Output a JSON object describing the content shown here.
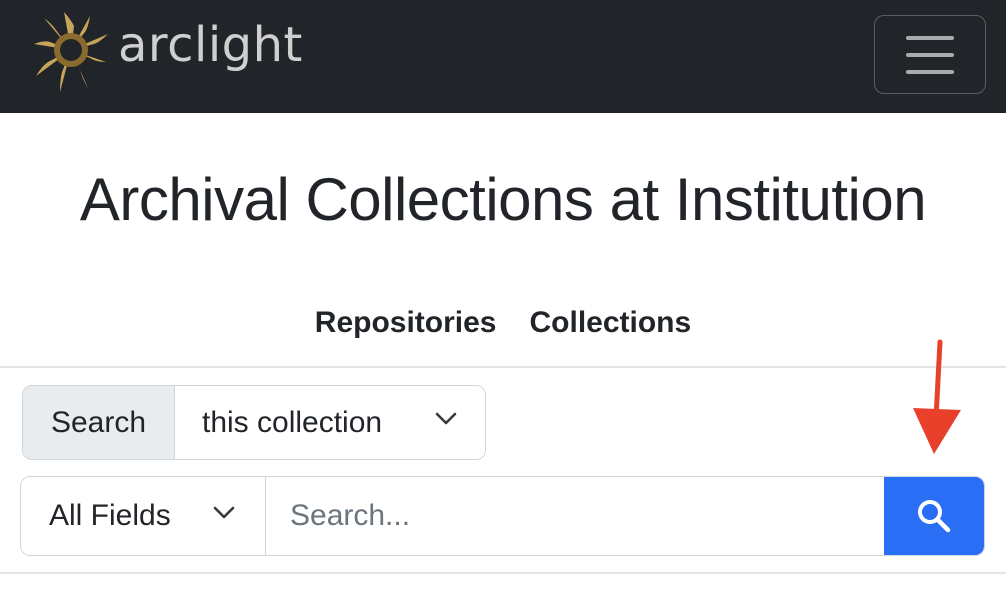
{
  "navbar": {
    "brand_name": "arclight",
    "brand_icon": "sun-logo-icon",
    "menu_icon": "hamburger-menu-icon",
    "background_color": "#212529"
  },
  "page": {
    "title": "Archival Collections at Institution"
  },
  "nav_links": [
    {
      "label": "Repositories"
    },
    {
      "label": "Collections"
    }
  ],
  "scope": {
    "label": "Search",
    "selected": "this collection"
  },
  "search": {
    "field_selected": "All Fields",
    "placeholder": "Search...",
    "button_icon": "search-icon",
    "button_color": "#2b6ef6"
  },
  "annotation": {
    "icon": "arrow-down-icon",
    "color": "#e8402a"
  }
}
